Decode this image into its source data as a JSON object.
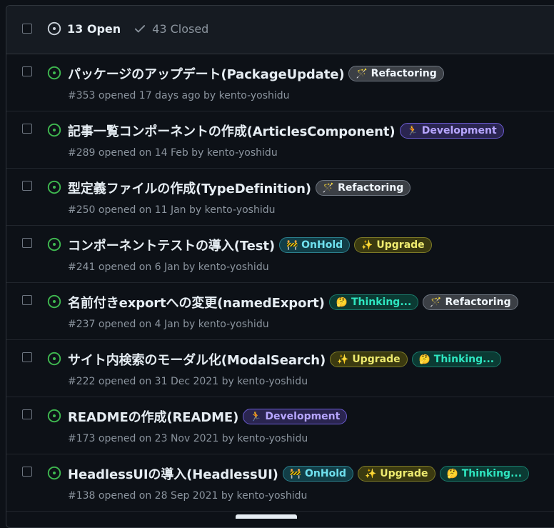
{
  "header": {
    "open_label": "13 Open",
    "closed_label": "43 Closed"
  },
  "colors": {
    "open_icon": "#3fb950",
    "background": "#0d1117"
  },
  "issues": [
    {
      "title": "パッケージのアップデート(PackageUpdate)",
      "meta": "#353 opened 17 days ago by kento-yoshidu",
      "labels": [
        {
          "text": "Refactoring",
          "emoji": "🪄",
          "kind": "refactoring"
        }
      ]
    },
    {
      "title": "記事一覧コンポーネントの作成(ArticlesComponent)",
      "meta": "#289 opened on 14 Feb by kento-yoshidu",
      "labels": [
        {
          "text": "Development",
          "emoji": "🏃",
          "kind": "development"
        }
      ]
    },
    {
      "title": "型定義ファイルの作成(TypeDefinition)",
      "meta": "#250 opened on 11 Jan by kento-yoshidu",
      "labels": [
        {
          "text": "Refactoring",
          "emoji": "🪄",
          "kind": "refactoring"
        }
      ]
    },
    {
      "title": "コンポーネントテストの導入(Test)",
      "meta": "#241 opened on 6 Jan by kento-yoshidu",
      "labels": [
        {
          "text": "OnHold",
          "emoji": "🚧",
          "kind": "onhold"
        },
        {
          "text": "Upgrade",
          "emoji": "✨",
          "kind": "upgrade"
        }
      ]
    },
    {
      "title": "名前付きexportへの変更(namedExport)",
      "meta": "#237 opened on 4 Jan by kento-yoshidu",
      "labels": [
        {
          "text": "Thinking...",
          "emoji": "🤔",
          "kind": "thinking"
        },
        {
          "text": "Refactoring",
          "emoji": "🪄",
          "kind": "refactoring"
        }
      ]
    },
    {
      "title": "サイト内検索のモーダル化(ModalSearch)",
      "meta": "#222 opened on 31 Dec 2021 by kento-yoshidu",
      "labels": [
        {
          "text": "Upgrade",
          "emoji": "✨",
          "kind": "upgrade"
        },
        {
          "text": "Thinking...",
          "emoji": "🤔",
          "kind": "thinking"
        }
      ]
    },
    {
      "title": "READMEの作成(README)",
      "meta": "#173 opened on 23 Nov 2021 by kento-yoshidu",
      "labels": [
        {
          "text": "Development",
          "emoji": "🏃",
          "kind": "development"
        }
      ]
    },
    {
      "title": "HeadlessUIの導入(HeadlessUI)",
      "meta": "#138 opened on 28 Sep 2021 by kento-yoshidu",
      "labels": [
        {
          "text": "OnHold",
          "emoji": "🚧",
          "kind": "onhold"
        },
        {
          "text": "Upgrade",
          "emoji": "✨",
          "kind": "upgrade"
        },
        {
          "text": "Thinking...",
          "emoji": "🤔",
          "kind": "thinking"
        }
      ]
    }
  ]
}
